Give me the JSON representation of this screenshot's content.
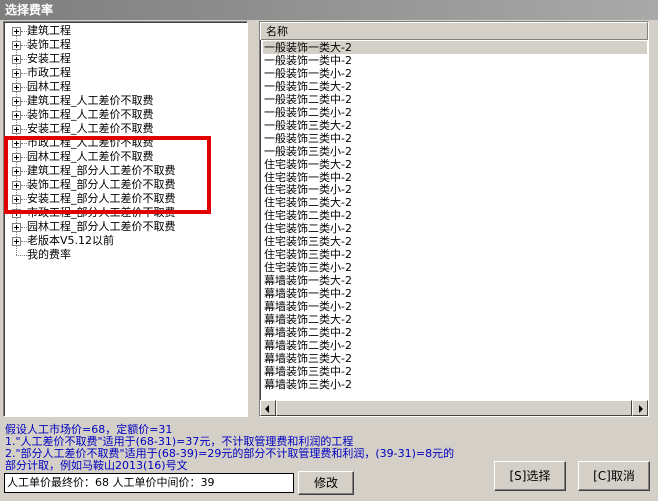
{
  "window": {
    "title": "选择费率"
  },
  "tree": {
    "items": [
      {
        "label": "建筑工程",
        "expandable": true
      },
      {
        "label": "装饰工程",
        "expandable": true
      },
      {
        "label": "安装工程",
        "expandable": true
      },
      {
        "label": "市政工程",
        "expandable": true
      },
      {
        "label": "园林工程",
        "expandable": true
      },
      {
        "label": "建筑工程_人工差价不取费",
        "expandable": true
      },
      {
        "label": "装饰工程_人工差价不取费",
        "expandable": true
      },
      {
        "label": "安装工程_人工差价不取费",
        "expandable": true
      },
      {
        "label": "市政工程_人工差价不取费",
        "expandable": true
      },
      {
        "label": "园林工程_人工差价不取费",
        "expandable": true
      },
      {
        "label": "建筑工程_部分人工差价不取费",
        "expandable": true
      },
      {
        "label": "装饰工程_部分人工差价不取费",
        "expandable": true
      },
      {
        "label": "安装工程_部分人工差价不取费",
        "expandable": true
      },
      {
        "label": "市政工程_部分人工差价不取费",
        "expandable": true
      },
      {
        "label": "园林工程_部分人工差价不取费",
        "expandable": true
      },
      {
        "label": "老版本V5.12以前",
        "expandable": true
      },
      {
        "label": "我的费率",
        "expandable": false
      }
    ],
    "highlight_color": "#e00000"
  },
  "list": {
    "header": "名称",
    "items": [
      "一般装饰一类大-2",
      "一般装饰一类中-2",
      "一般装饰一类小-2",
      "一般装饰二类大-2",
      "一般装饰二类中-2",
      "一般装饰二类小-2",
      "一般装饰三类大-2",
      "一般装饰三类中-2",
      "一般装饰三类小-2",
      "住宅装饰一类大-2",
      "住宅装饰一类中-2",
      "住宅装饰一类小-2",
      "住宅装饰二类大-2",
      "住宅装饰二类中-2",
      "住宅装饰二类小-2",
      "住宅装饰三类大-2",
      "住宅装饰三类中-2",
      "住宅装饰三类小-2",
      "幕墙装饰一类大-2",
      "幕墙装饰一类中-2",
      "幕墙装饰一类小-2",
      "幕墙装饰二类大-2",
      "幕墙装饰二类中-2",
      "幕墙装饰二类小-2",
      "幕墙装饰三类大-2",
      "幕墙装饰三类中-2",
      "幕墙装饰三类小-2"
    ]
  },
  "notes": {
    "line1": "假设人工市场价=68，定额价=31",
    "line2": "1.\"人工差价不取费\"适用于(68-31)=37元，不计取管理费和利润的工程",
    "line3": "2.\"部分人工差价不取费\"适用于(68-39)=29元的部分不计取管理费和利润，(39-31)=8元的",
    "line4": "部分计取，例如马鞍山2013(16)号文",
    "color": "#0000c0"
  },
  "price_field": {
    "value": "人工单价最终价：68  人工单价中间价：39"
  },
  "buttons": {
    "modify": "修改",
    "select": "[S]选择",
    "cancel": "[C]取消"
  }
}
